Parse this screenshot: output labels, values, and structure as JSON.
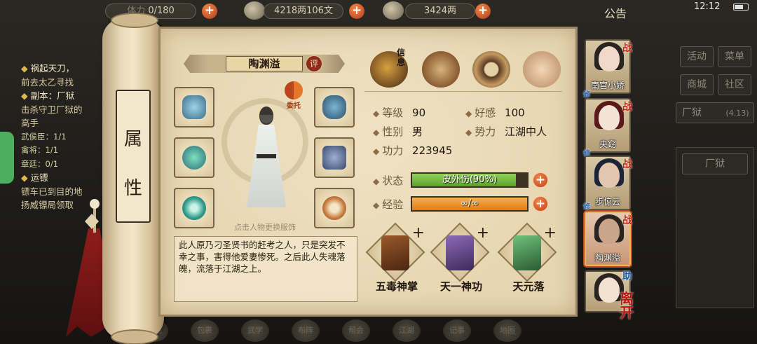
{
  "top_bar": {
    "stamina": "0/180",
    "stamina_label": "体力",
    "silver": "4218两106文",
    "gold": "3424两",
    "notice": "公告",
    "time": "12:12"
  },
  "quest_log": {
    "q1_title": "祸起天刀，",
    "q1_desc": "前去太乙寻找",
    "q2_title": "副本：厂狱",
    "q2_desc1": "击杀守卫厂狱的",
    "q2_desc2": "高手",
    "q2_line1": "武侯臣：1/1",
    "q2_line2": "禽将：1/1",
    "q2_line3": "章廷：0/1",
    "q3_title": "运镖",
    "q3_desc1": "镖车已到目的地",
    "q3_desc2": "扬威镖局领取"
  },
  "right_menu": {
    "activity": "活动",
    "menu": "菜单",
    "shop": "商城",
    "community": "社区",
    "dungeon": "厂狱",
    "dungeon_level": "(4.13)",
    "list_item": "厂狱"
  },
  "bottom_bar": [
    "角色",
    "包裹",
    "武学",
    "布阵",
    "帮会",
    "江湖",
    "记事",
    "地图"
  ],
  "scroll": {
    "title_char1": "属",
    "title_char2": "性"
  },
  "character": {
    "name": "陶渊溢",
    "rate_label": "评",
    "entrust_label": "委托",
    "change_hint": "点击人物更换服饰",
    "bio": "此人原乃刁圣贤书的赶考之人，只是突发不幸之事，害得他爱妻惨死。之后此人失魂落魄，流落于江湖之上。"
  },
  "tabs": {
    "info_label": "信息"
  },
  "stats": {
    "level_label": "等级",
    "level": "90",
    "favor_label": "好感",
    "favor": "100",
    "gender_label": "性别",
    "gender": "男",
    "faction_label": "势力",
    "faction": "江湖中人",
    "power_label": "功力",
    "power": "223945",
    "status_label": "状态",
    "status_text": "皮外伤(90%)",
    "status_fill": 0.9,
    "exp_label": "经验",
    "exp_text": "∞/∞",
    "exp_fill": 1.0
  },
  "skills": [
    {
      "name": "五毒神掌",
      "plus": "+"
    },
    {
      "name": "天一神功",
      "plus": "+"
    },
    {
      "name": "天元落",
      "plus": "+"
    }
  ],
  "roster": [
    {
      "name": "南宫小娇",
      "tag": "战",
      "sub": "修"
    },
    {
      "name": "央窈",
      "tag": "战",
      "sub": "修"
    },
    {
      "name": "步惊云",
      "tag": "战",
      "sub": "修"
    },
    {
      "name": "陶渊溢",
      "tag": "战",
      "sub": ""
    },
    {
      "name": "",
      "tag": "助",
      "sub": ""
    }
  ],
  "leave_label": "离开",
  "colors": {
    "status_bar": "#5fa12e",
    "exp_bar": "#e07a18",
    "accent_red": "#c53f18",
    "parchment": "#e7d6b1"
  }
}
